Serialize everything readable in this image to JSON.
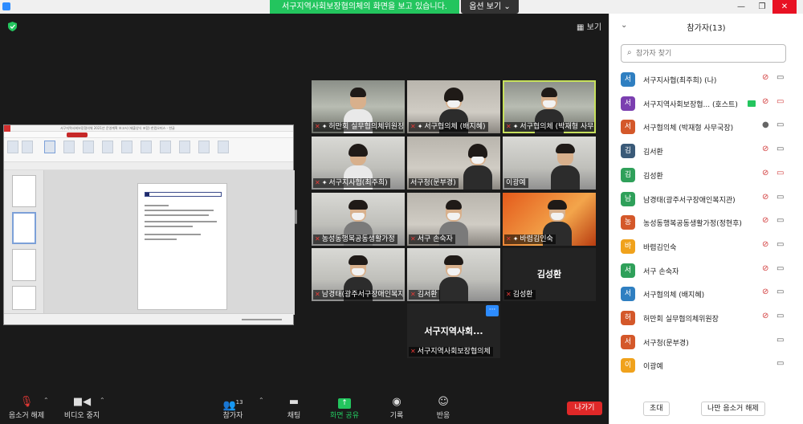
{
  "system": {
    "share_banner": "서구지역사회보장협의체의 화면을 보고 있습니다.",
    "view_options": "옵션 보기 ⌄",
    "minimize": "—",
    "maximize": "❐",
    "close": "✕"
  },
  "main": {
    "view_button": "▦ 보기",
    "shared_screen": {
      "window_title": "서구지역사회보장협의체 2021년 운영계획 보고서 (제출양식 포함) 한컴오피스 - 한글",
      "document_heading": "2021년 서구지역사회보장협의체 운영계획"
    }
  },
  "tiles": [
    {
      "name": "허만회 실무협의체위원장",
      "muted": true
    },
    {
      "name": "서구협의체 (배지혜)",
      "muted": true
    },
    {
      "name": "서구협의체 (박재형 사무국장)",
      "muted": true
    },
    {
      "name": "서구지사협(최주희)",
      "muted": true
    },
    {
      "name": "서구청(문부경)",
      "muted": false
    },
    {
      "name": "이광예",
      "muted": false
    },
    {
      "name": "농성동행복공동생활가정",
      "muted": true
    },
    {
      "name": "서구 손숙자",
      "muted": true
    },
    {
      "name": "바렴김인숙",
      "muted": true
    },
    {
      "name": "남경태(광주서구장애인복지관)",
      "muted": true
    },
    {
      "name": "김서환",
      "muted": true
    },
    {
      "name": "김성환",
      "muted": true,
      "big": "김성환"
    },
    {
      "name": "서구지역사회보장협의체",
      "muted": true,
      "big": "서구지역사회..."
    }
  ],
  "toolbar": {
    "unmute": "음소거 해제",
    "stop_video": "비디오 중지",
    "participants": "참가자",
    "participants_count": "13",
    "chat": "채팅",
    "share_screen": "화면 공유",
    "record": "기록",
    "reactions": "반응",
    "leave": "나가기"
  },
  "panel": {
    "title": "참가자(13)",
    "search_placeholder": "참가자 찾기",
    "participants": [
      {
        "initial": "서",
        "color": "#2f7fc1",
        "name": "서구지사협(최주희) (나)",
        "mic": "muted",
        "cam": "off"
      },
      {
        "initial": "서",
        "color": "#7b3fb0",
        "name": "서구지역사회보장협... (호스트)",
        "mic": "muted",
        "cam": "off-red",
        "rec": true
      },
      {
        "initial": "서",
        "color": "#d4582a",
        "name": "서구협의체 (박재형 사무국장)",
        "mic": "on",
        "cam": "off"
      },
      {
        "initial": "김",
        "color": "#3a5a78",
        "name": "김서환",
        "mic": "muted",
        "cam": "off"
      },
      {
        "initial": "김",
        "color": "#2fa05a",
        "name": "김성환",
        "mic": "muted",
        "cam": "off-red"
      },
      {
        "initial": "남",
        "color": "#2fa05a",
        "name": "남경태(광주서구장애인복지관)",
        "mic": "muted",
        "cam": "off"
      },
      {
        "initial": "농",
        "color": "#d4582a",
        "name": "농성동행복공동생활가정(정현후)",
        "mic": "muted",
        "cam": "off"
      },
      {
        "initial": "바",
        "color": "#f0a21c",
        "name": "바렴김인숙",
        "mic": "muted",
        "cam": "off"
      },
      {
        "initial": "서",
        "color": "#2fa05a",
        "name": "서구 손숙자",
        "mic": "muted",
        "cam": "off"
      },
      {
        "initial": "서",
        "color": "#2f7fc1",
        "name": "서구협의체 (배지혜)",
        "mic": "muted",
        "cam": "off"
      },
      {
        "initial": "허",
        "color": "#d4582a",
        "name": "허만회 실무협의체위원장",
        "mic": "muted",
        "cam": "off"
      },
      {
        "initial": "서",
        "color": "#d4582a",
        "name": "서구청(문부경)",
        "mic": "none",
        "cam": "off"
      },
      {
        "initial": "이",
        "color": "#f0a21c",
        "name": "이광예",
        "mic": "none",
        "cam": "off"
      }
    ],
    "invite": "초대",
    "unmute_me": "나만 음소거 해제"
  }
}
